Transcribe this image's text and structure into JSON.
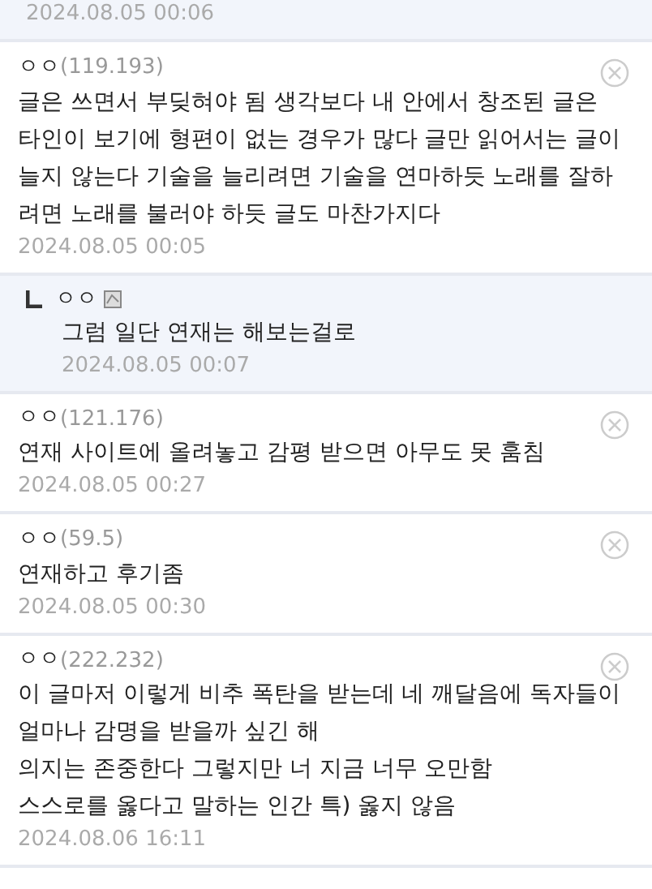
{
  "comments": [
    {
      "kind": "reply",
      "date": "2024.08.05 00:06"
    },
    {
      "kind": "comment",
      "nick": "ㅇㅇ",
      "ip": "(119.193)",
      "lines": [
        "글은 쓰면서 부딪혀야 됨 생각보다 내 안에서 창조된 글은 타인이 보기에 형편이 없는 경우가 많다 글만 읽어서는 글이 늘지 않는다 기술을 늘리려면 기술을 연마하듯 노래를 잘하려면 노래를 불러야 하듯 글도 마찬가지다"
      ],
      "date": "2024.08.05 00:05"
    },
    {
      "kind": "reply",
      "nick": "ㅇㅇ",
      "lines": [
        "그럼 일단 연재는 해보는걸로"
      ],
      "date": "2024.08.05 00:07"
    },
    {
      "kind": "comment",
      "nick": "ㅇㅇ",
      "ip": "(121.176)",
      "lines": [
        "연재 사이트에 올려놓고 감평 받으면 아무도 못 훔침"
      ],
      "date": "2024.08.05 00:27"
    },
    {
      "kind": "comment",
      "nick": "ㅇㅇ",
      "ip": "(59.5)",
      "lines": [
        "연재하고 후기좀"
      ],
      "date": "2024.08.05 00:30"
    },
    {
      "kind": "comment",
      "nick": "ㅇㅇ",
      "ip": "(222.232)",
      "lines": [
        "이 글마저 이렇게 비추 폭탄을 받는데 네 깨달음에 독자들이 얼마나 감명을 받을까 싶긴 해",
        "의지는 존중한다 그렇지만 너 지금 너무 오만함",
        "스스로를 옳다고 말하는 인간 특) 옳지 않음"
      ],
      "date": "2024.08.06 16:11"
    }
  ]
}
